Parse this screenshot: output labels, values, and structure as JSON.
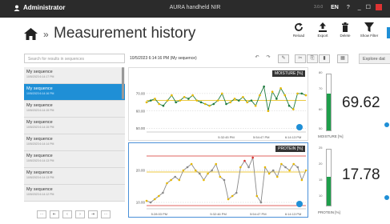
{
  "titlebar": {
    "user": "Administrator",
    "app_title": "AURA handheld NIR",
    "version": "3.0.0",
    "language": "EN",
    "help": "?",
    "min": "_",
    "max": "☐"
  },
  "header": {
    "title": "Measurement history",
    "tools": [
      {
        "label": "Reload",
        "icon": "reload-icon"
      },
      {
        "label": "Export",
        "icon": "export-icon"
      },
      {
        "label": "Delete",
        "icon": "trash-icon"
      },
      {
        "label": "Show Filter",
        "icon": "filter-icon"
      }
    ]
  },
  "sidebar": {
    "search_placeholder": "Search for results in sequences",
    "items": [
      {
        "name": "My sequence",
        "date": "10/5/2023 6:14:17 PM"
      },
      {
        "name": "My sequence",
        "date": "10/5/2023 6:14:16 PM",
        "selected": true
      },
      {
        "name": "My sequence",
        "date": "10/5/2023 6:14:15 PM"
      },
      {
        "name": "My sequence",
        "date": "10/5/2023 6:14:15 PM"
      },
      {
        "name": "My sequence",
        "date": "10/5/2023 6:14:14 PM"
      },
      {
        "name": "My sequence",
        "date": "10/5/2023 6:14:13 PM"
      },
      {
        "name": "My sequence",
        "date": "10/5/2023 6:14:13 PM"
      },
      {
        "name": "My sequence",
        "date": "10/5/2023 6:14:12 PM"
      }
    ],
    "pager": [
      "⋯",
      "⇤",
      "‹",
      "›",
      "⇥",
      "⋯"
    ]
  },
  "main": {
    "sequence_title": "10/5/2023 6:14:16 PM (My sequence)",
    "explore_label": "Explore dat"
  },
  "chart_data": [
    {
      "type": "line",
      "title": "MOISTURE [%]",
      "ylim": [
        48,
        80
      ],
      "y_ticks": [
        "70.00",
        "60.00",
        "50.00"
      ],
      "x_ticks": [
        "5:32:45 PM",
        "5:54:47 PM",
        "6:14:13 PM"
      ],
      "series": [
        {
          "values": [
            65,
            66,
            67,
            64,
            63,
            66,
            69,
            65,
            66,
            68,
            67,
            69,
            66,
            65,
            64,
            63,
            64,
            66,
            70,
            64,
            65,
            67,
            66,
            68,
            65,
            66,
            63,
            69,
            74,
            60,
            71,
            67,
            73,
            69,
            63,
            61,
            70,
            70,
            69
          ]
        }
      ],
      "color": "#1e7a3e",
      "highlight_color": "#e6b800"
    },
    {
      "type": "line",
      "title": "PROTEIN [%]",
      "ylim": [
        8,
        26
      ],
      "y_ticks": [
        "20.00",
        "10.00"
      ],
      "x_ticks": [
        "5:28:03 PM",
        "5:32:46 PM",
        "5:54:47 PM",
        "6:14:13 PM"
      ],
      "series": [
        {
          "values": [
            10.5,
            10,
            11,
            12,
            13,
            16,
            17,
            18,
            17,
            20,
            21,
            22,
            20,
            19,
            17,
            19,
            20,
            22,
            18,
            17,
            11,
            12,
            13,
            21,
            23,
            21,
            24,
            12,
            10,
            21,
            19,
            20,
            18,
            22,
            21,
            20,
            22,
            21,
            17,
            20
          ]
        }
      ],
      "color": "#888888",
      "highlight_color": "#e6b800",
      "limit_color": "#d9302c"
    }
  ],
  "gauges": [
    {
      "value": "69.62",
      "unit": "MOISTURE [%]",
      "scale": [
        "80",
        "70",
        "60",
        "50"
      ],
      "fill_fraction": 0.66
    },
    {
      "value": "17.78",
      "unit": "PROTEIN [%]",
      "scale": [
        "25",
        "20",
        "15",
        "10"
      ],
      "fill_fraction": 0.52
    }
  ],
  "colors": {
    "accent": "#1f8fd6",
    "titlebar": "#2b2b2b",
    "gauge_fill": "#1e9e4a"
  }
}
